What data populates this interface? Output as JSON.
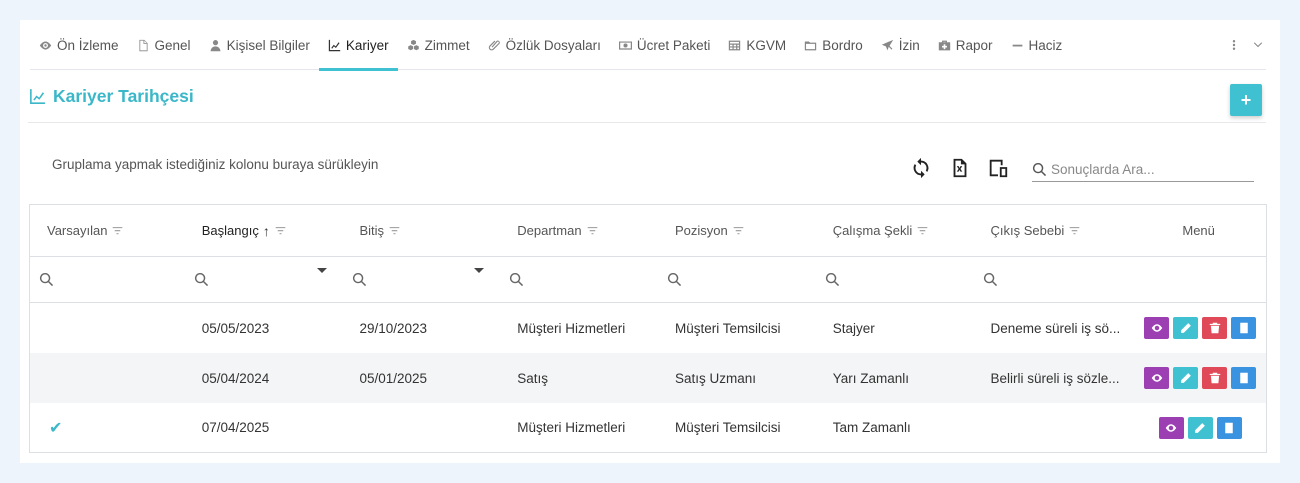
{
  "tabs": [
    {
      "label": "Ön İzleme",
      "icon": "eye-icon",
      "active": false
    },
    {
      "label": "Genel",
      "icon": "file-icon",
      "active": false
    },
    {
      "label": "Kişisel Bilgiler",
      "icon": "user-icon",
      "active": false
    },
    {
      "label": "Kariyer",
      "icon": "line-chart-icon",
      "active": true
    },
    {
      "label": "Zimmet",
      "icon": "cubes-icon",
      "active": false
    },
    {
      "label": "Özlük Dosyaları",
      "icon": "paperclip-icon",
      "active": false
    },
    {
      "label": "Ücret Paketi",
      "icon": "money-icon",
      "active": false
    },
    {
      "label": "KGVM",
      "icon": "calculator-icon",
      "active": false
    },
    {
      "label": "Bordro",
      "icon": "folder-icon",
      "active": false
    },
    {
      "label": "İzin",
      "icon": "plane-icon",
      "active": false
    },
    {
      "label": "Rapor",
      "icon": "medkit-icon",
      "active": false
    },
    {
      "label": "Haciz",
      "icon": "minus-icon",
      "active": false
    }
  ],
  "section": {
    "title": "Kariyer Tarihçesi",
    "add_label": "+"
  },
  "toolbar": {
    "group_hint": "Gruplama yapmak istediğiniz kolonu buraya sürükleyin",
    "search_placeholder": "Sonuçlarda Ara..."
  },
  "grid": {
    "columns": [
      "Varsayılan",
      "Başlangıç",
      "Bitiş",
      "Departman",
      "Pozisyon",
      "Çalışma Şekli",
      "Çıkış Sebebi",
      "Menü"
    ],
    "rows": [
      {
        "default": "",
        "start": "05/05/2023",
        "end": "29/10/2023",
        "department": "Müşteri Hizmetleri",
        "position": "Müşteri Temsilcisi",
        "work_type": "Stajyer",
        "exit_reason": "Deneme süreli iş sö...",
        "actions": [
          "view",
          "edit",
          "delete",
          "doc"
        ]
      },
      {
        "default": "",
        "start": "05/04/2024",
        "end": "05/01/2025",
        "department": "Satış",
        "position": "Satış Uzmanı",
        "work_type": "Yarı Zamanlı",
        "exit_reason": "Belirli süreli iş sözle...",
        "actions": [
          "view",
          "edit",
          "delete",
          "doc"
        ]
      },
      {
        "default": "✔",
        "start": "07/04/2025",
        "end": "",
        "department": "Müşteri Hizmetleri",
        "position": "Müşteri Temsilcisi",
        "work_type": "Tam Zamanlı",
        "exit_reason": "",
        "actions": [
          "view",
          "edit",
          "doc"
        ]
      }
    ]
  },
  "colors": {
    "accent": "#3fc1d2",
    "view": "#9c3fb3",
    "edit": "#3fc1d2",
    "delete": "#e04a58",
    "doc": "#3a93e0"
  }
}
